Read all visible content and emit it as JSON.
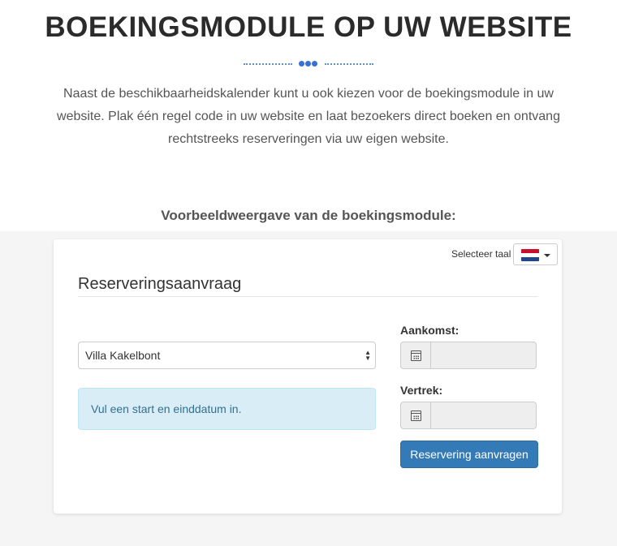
{
  "hero": {
    "title": "BOEKINGSMODULE OP UW WEBSITE",
    "intro": "Naast de beschikbaarheidskalender kunt u ook kiezen voor de boekingsmodule in uw website. Plak één regel code in uw website en laat bezoekers direct boeken en ontvang rechtstreeks reserveringen via uw eigen website.",
    "preview_label": "Voorbeeldweergave van de boekingsmodule:",
    "accent_color": "#3a6fd6"
  },
  "widget": {
    "language_label": "Selecteer taal",
    "language_flag": "flag-netherlands-icon",
    "form_title": "Reserveringsaanvraag",
    "accommodation": {
      "selected": "Villa Kakelbont"
    },
    "info_message": "Vul een start en einddatum in.",
    "arrival": {
      "label": "Aankomst:",
      "value": "",
      "icon": "calendar-icon"
    },
    "departure": {
      "label": "Vertrek:",
      "value": "",
      "icon": "calendar-icon"
    },
    "submit_label": "Reservering aanvragen",
    "button_color": "#337ab7",
    "info_color": "#d9edf7"
  }
}
